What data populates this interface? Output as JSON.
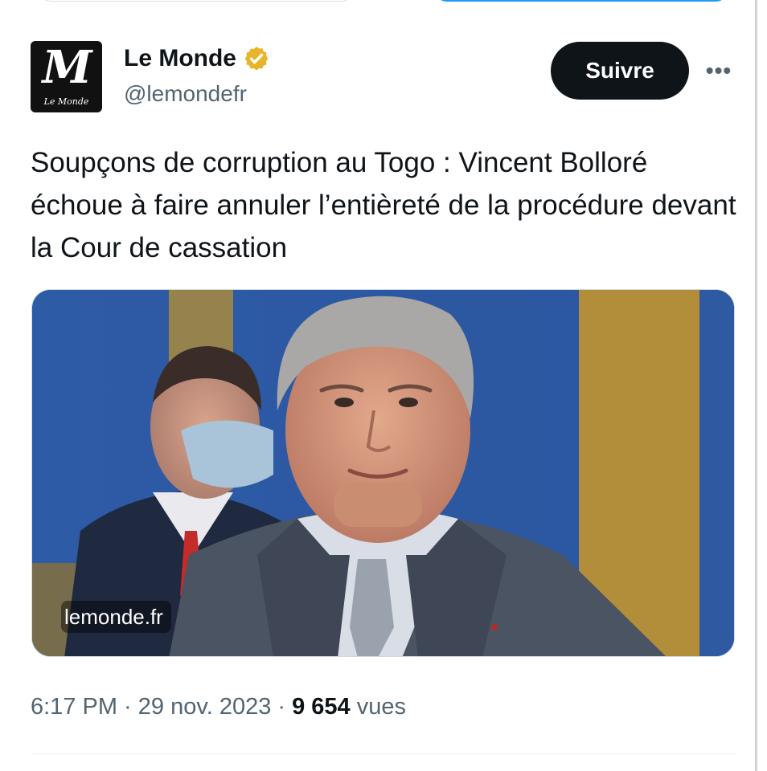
{
  "account": {
    "display_name": "Le Monde",
    "handle": "@lemondefr",
    "avatar_letter": "M",
    "avatar_wordmark": "Le Monde",
    "verified_color": "#e8b42a"
  },
  "actions": {
    "follow_label": "Suivre",
    "more_label": "•••"
  },
  "tweet": {
    "text": "Soupçons de corruption au Togo : Vincent Bolloré échoue à faire annuler l’entièreté de la procédure devant la Cour de cassation"
  },
  "card": {
    "domain": "lemonde.fr"
  },
  "meta": {
    "time": "6:17 PM",
    "separator": " · ",
    "date": "29 nov. 2023",
    "views_count": "9 654",
    "views_label": " vues"
  },
  "colors": {
    "text_primary": "#0f1419",
    "text_secondary": "#536471",
    "button_bg": "#0f1419",
    "photo_background": "#2c5aa8"
  }
}
